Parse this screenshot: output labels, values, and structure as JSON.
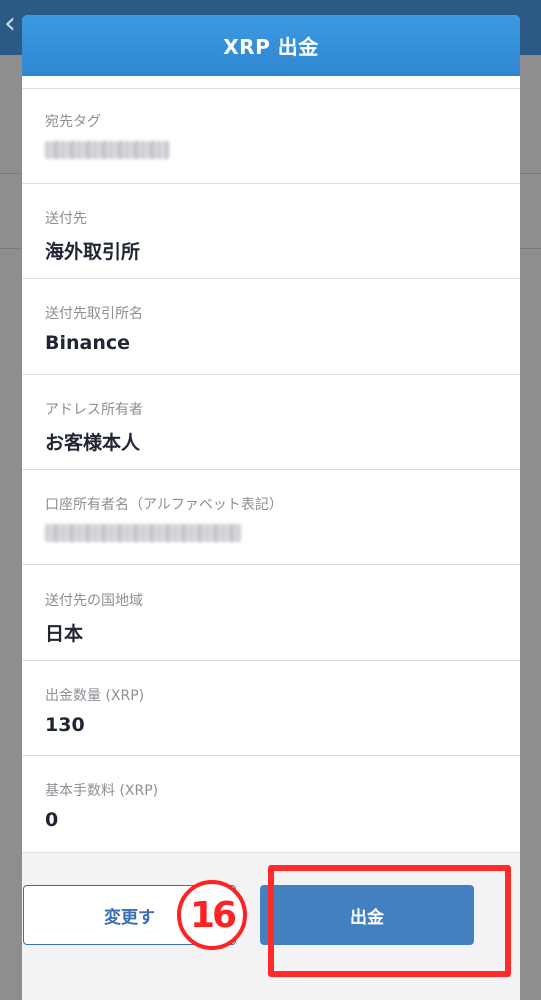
{
  "modal": {
    "title": "XRP 出金"
  },
  "rows": [
    {
      "label": "宛先タグ",
      "value": null,
      "blurred": true
    },
    {
      "label": "送付先",
      "value": "海外取引所"
    },
    {
      "label": "送付先取引所名",
      "value": "Binance"
    },
    {
      "label": "アドレス所有者",
      "value": "お客様本人"
    },
    {
      "label": "口座所有者名（アルファベット表記）",
      "value": null,
      "blurred": true
    },
    {
      "label": "送付先の国地域",
      "value": "日本"
    },
    {
      "label": "出金数量 (XRP)",
      "value": "130"
    },
    {
      "label": "基本手数料 (XRP)",
      "value": "0"
    }
  ],
  "buttons": {
    "change_label": "変更す",
    "withdraw_label": "出金"
  },
  "annotation": {
    "step_number": "16",
    "step_color": "#ff2222"
  },
  "colors": {
    "header_blue": "#2e86d0",
    "primary_button": "#4380c0"
  }
}
